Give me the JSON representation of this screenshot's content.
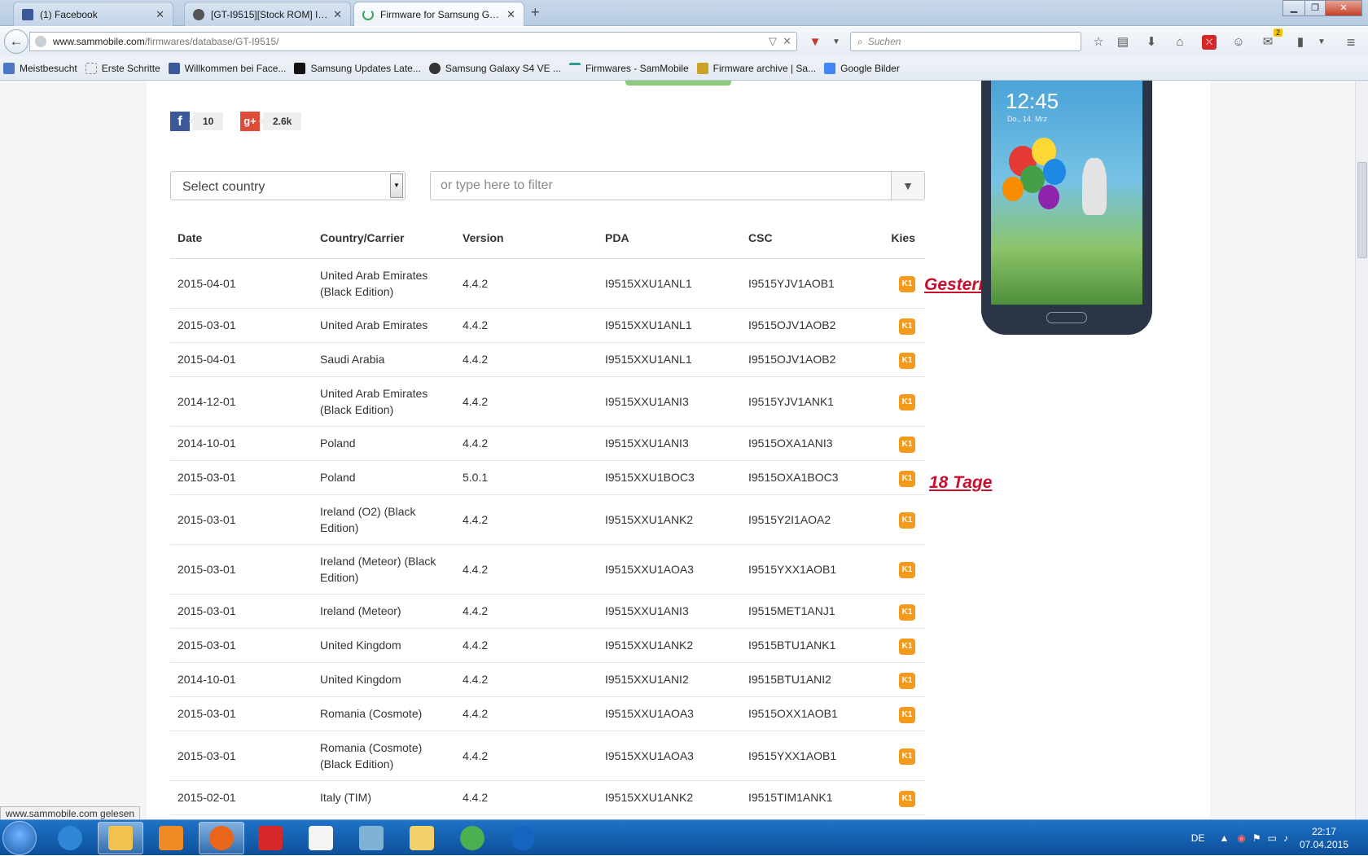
{
  "browser": {
    "tabs": [
      {
        "label": "(1) Facebook",
        "icon": "facebook-icon",
        "color": "#3b5998"
      },
      {
        "label": "[GT-I9515][Stock ROM] I95...",
        "icon": "android-icon",
        "color": "#555555"
      },
      {
        "label": "Firmware for Samsung GT-...",
        "icon": "loading-icon",
        "color": "#3aa757"
      }
    ],
    "url_host": "www.sammobile.com",
    "url_path": "/firmwares/database/GT-I9515/",
    "search_placeholder": "Suchen",
    "notification_count": "2",
    "bookmarks": [
      {
        "label": "Meistbesucht",
        "icon": "gear-icon",
        "color": "#4a78c2"
      },
      {
        "label": "Erste Schritte",
        "icon": "page-icon",
        "color": "#cccccc"
      },
      {
        "label": "Willkommen bei Face...",
        "icon": "facebook-icon",
        "color": "#3b5998"
      },
      {
        "label": "Samsung Updates Late...",
        "icon": "su-icon",
        "color": "#111111"
      },
      {
        "label": "Samsung Galaxy S4 VE ...",
        "icon": "android-icon",
        "color": "#333333"
      },
      {
        "label": "Firmwares - SamMobile",
        "icon": "sammobile-icon",
        "color": "#2a9d8f"
      },
      {
        "label": "Firmware archive | Sa...",
        "icon": "archive-icon",
        "color": "#c9a227"
      },
      {
        "label": "Google Bilder",
        "icon": "google-icon",
        "color": "#4285f4"
      }
    ],
    "status_text": "www.sammobile.com gelesen"
  },
  "page": {
    "share": {
      "facebook_count": "10",
      "facebook_glyph": "f",
      "gplus_count": "2.6k",
      "gplus_glyph": "g+"
    },
    "country_select": "Select country",
    "filter_placeholder": "or type here to filter",
    "columns": [
      "Date",
      "Country/Carrier",
      "Version",
      "PDA",
      "CSC",
      "Kies"
    ],
    "kies_badge": "K1",
    "rows": [
      {
        "date": "2015-04-01",
        "country": "United Arab Emirates (Black Edition)",
        "version": "4.4.2",
        "pda": "I9515XXU1ANL1",
        "csc": "I9515YJV1AOB1"
      },
      {
        "date": "2015-03-01",
        "country": "United Arab Emirates",
        "version": "4.4.2",
        "pda": "I9515XXU1ANL1",
        "csc": "I9515OJV1AOB2"
      },
      {
        "date": "2015-04-01",
        "country": "Saudi Arabia",
        "version": "4.4.2",
        "pda": "I9515XXU1ANL1",
        "csc": "I9515OJV1AOB2"
      },
      {
        "date": "2014-12-01",
        "country": "United Arab Emirates (Black Edition)",
        "version": "4.4.2",
        "pda": "I9515XXU1ANI3",
        "csc": "I9515YJV1ANK1"
      },
      {
        "date": "2014-10-01",
        "country": "Poland",
        "version": "4.4.2",
        "pda": "I9515XXU1ANI3",
        "csc": "I9515OXA1ANI3"
      },
      {
        "date": "2015-03-01",
        "country": "Poland",
        "version": "5.0.1",
        "pda": "I9515XXU1BOC3",
        "csc": "I9515OXA1BOC3"
      },
      {
        "date": "2015-03-01",
        "country": "Ireland (O2) (Black Edition)",
        "version": "4.4.2",
        "pda": "I9515XXU1ANK2",
        "csc": "I9515Y2I1AOA2"
      },
      {
        "date": "2015-03-01",
        "country": "Ireland (Meteor) (Black Edition)",
        "version": "4.4.2",
        "pda": "I9515XXU1AOA3",
        "csc": "I9515YXX1AOB1"
      },
      {
        "date": "2015-03-01",
        "country": "Ireland (Meteor)",
        "version": "4.4.2",
        "pda": "I9515XXU1ANI3",
        "csc": "I9515MET1ANJ1"
      },
      {
        "date": "2015-03-01",
        "country": "United Kingdom",
        "version": "4.4.2",
        "pda": "I9515XXU1ANK2",
        "csc": "I9515BTU1ANK1"
      },
      {
        "date": "2014-10-01",
        "country": "United Kingdom",
        "version": "4.4.2",
        "pda": "I9515XXU1ANI2",
        "csc": "I9515BTU1ANI2"
      },
      {
        "date": "2015-03-01",
        "country": "Romania (Cosmote)",
        "version": "4.4.2",
        "pda": "I9515XXU1AOA3",
        "csc": "I9515OXX1AOB1"
      },
      {
        "date": "2015-03-01",
        "country": "Romania (Cosmote) (Black Edition)",
        "version": "4.4.2",
        "pda": "I9515XXU1AOA3",
        "csc": "I9515YXX1AOB1"
      },
      {
        "date": "2015-02-01",
        "country": "Italy (TIM)",
        "version": "4.4.2",
        "pda": "I9515XXU1ANK2",
        "csc": "I9515TIM1ANK1"
      }
    ],
    "annotations": {
      "gestern": "Gestern",
      "tage": "18 Tage"
    },
    "phone": {
      "time": "12:45",
      "date": "Do., 14. Mrz"
    }
  },
  "taskbar": {
    "apps": [
      {
        "icon": "ie-icon",
        "color": "#2f86d6",
        "active": false
      },
      {
        "icon": "explorer-icon",
        "color": "#f2c14e",
        "active": true
      },
      {
        "icon": "media-player-icon",
        "color": "#f08a24",
        "active": false
      },
      {
        "icon": "firefox-icon",
        "color": "#e8651a",
        "active": true
      },
      {
        "icon": "paint-splash-icon",
        "color": "#d62828",
        "active": false
      },
      {
        "icon": "flashtool-icon",
        "color": "#f4f4f4",
        "active": false
      },
      {
        "icon": "network-icon",
        "color": "#7fb3d5",
        "active": false
      },
      {
        "icon": "folder-icon",
        "color": "#f2d16b",
        "active": false
      },
      {
        "icon": "chrome-icon",
        "color": "#4caf50",
        "active": false
      },
      {
        "icon": "google-earth-icon",
        "color": "#1565c0",
        "active": false
      }
    ],
    "language": "DE",
    "time": "22:17",
    "date": "07.04.2015"
  }
}
